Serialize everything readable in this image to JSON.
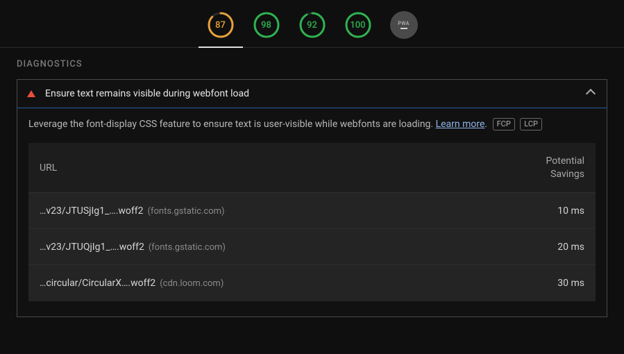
{
  "scores": {
    "items": [
      {
        "value": "87",
        "color": "#e8a23a",
        "pct": 87,
        "cls": "score-orange"
      },
      {
        "value": "98",
        "color": "#2fb350",
        "pct": 98,
        "cls": "score-green"
      },
      {
        "value": "92",
        "color": "#2fb350",
        "pct": 92,
        "cls": "score-green"
      },
      {
        "value": "100",
        "color": "#2fb350",
        "pct": 100,
        "cls": "score-green"
      }
    ],
    "pwa_label": "PWA"
  },
  "section_title": "DIAGNOSTICS",
  "audit": {
    "title": "Ensure text remains visible during webfont load",
    "description_pre": "Leverage the font-display CSS feature to ensure text is user-visible while webfonts are loading. ",
    "learn_more": "Learn more",
    "description_post": ".",
    "tags": [
      "FCP",
      "LCP"
    ],
    "table": {
      "col_url": "URL",
      "col_savings": "Potential Savings",
      "rows": [
        {
          "path": "…v23/JTUSjIg1_….woff2",
          "host": "(fonts.gstatic.com)",
          "savings": "10 ms"
        },
        {
          "path": "…v23/JTUQjIg1_….woff2",
          "host": "(fonts.gstatic.com)",
          "savings": "20 ms"
        },
        {
          "path": "…circular/CircularX….woff2",
          "host": "(cdn.loom.com)",
          "savings": "30 ms"
        }
      ]
    }
  }
}
